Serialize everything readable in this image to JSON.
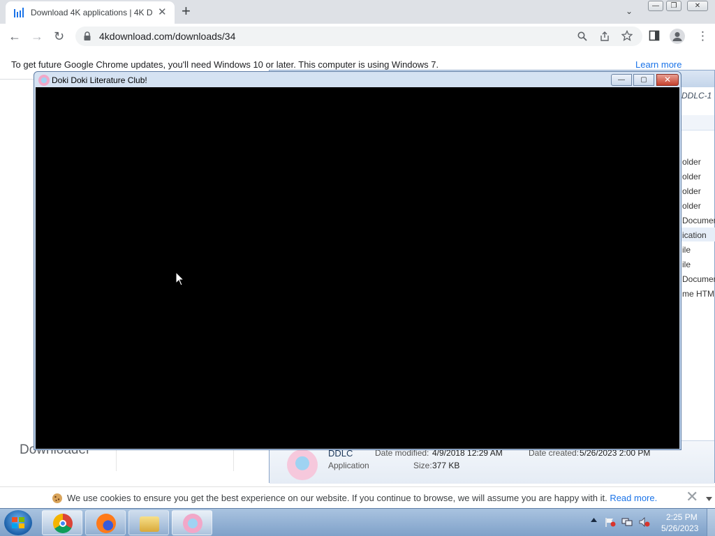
{
  "browser": {
    "tab_title": "Download 4K applications | 4K D",
    "tab_close": "✕",
    "new_tab": "+",
    "tab_search": "⌄",
    "win_min": "—",
    "win_restore": "❐",
    "win_close": "✕",
    "back": "←",
    "forward": "→",
    "reload": "↻",
    "url": "4kdownload.com/downloads/34",
    "menu": "⋮",
    "infobar_text": "To get future Google Chrome updates, you'll need Windows 10 or later. This computer is using Windows 7.",
    "infobar_link": "Learn more"
  },
  "page": {
    "logo_text": "Downloader"
  },
  "explorer": {
    "path_fragment": "DDLC-1",
    "rows": [
      "older",
      "older",
      "older",
      "older",
      "Documen",
      "ication",
      "ile",
      "ile",
      "Documen",
      "me HTM"
    ],
    "details": {
      "name": "DDLC",
      "type": "Application",
      "date_modified_label": "Date modified:",
      "date_modified": "4/9/2018 12:29 AM",
      "date_created_label": "Date created:",
      "date_created": "5/26/2023 2:00 PM",
      "size_label": "Size:",
      "size": "377 KB"
    }
  },
  "game_window": {
    "title": "Doki Doki Literature Club!",
    "min": "—",
    "max": "▢",
    "close": "✕"
  },
  "cookie_bar": {
    "text": "We use cookies to ensure you get the best experience on our website. If you continue to browse, we will assume you are happy with it.",
    "link": "Read more.",
    "close": "✕"
  },
  "taskbar": {
    "clock_time": "2:25 PM",
    "clock_date": "5/26/2023"
  },
  "colors": {
    "chrome_tabbar": "#dee1e6",
    "game_viewport": "#000000",
    "taskbar": "#7fa1c9",
    "link": "#1a73e8"
  }
}
